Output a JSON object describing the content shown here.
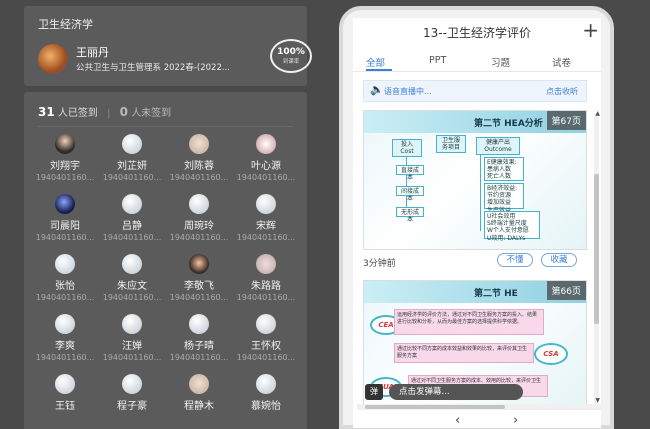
{
  "course": {
    "title": "卫生经济学",
    "teacher_name": "王丽丹",
    "teacher_org": "公共卫生与卫生管理系 2022春-(2022...",
    "progress_pct": "100%",
    "progress_label": "到课率"
  },
  "attendance": {
    "signed_count": "31",
    "signed_label": "人已签到",
    "separator": "|",
    "unsigned_count": "0",
    "unsigned_label": "人未签到",
    "students": [
      {
        "name": "刘翔宇",
        "id": "1940401160...",
        "avatar": "photo1"
      },
      {
        "name": "刘芷妍",
        "id": "1940401160...",
        "avatar": "default"
      },
      {
        "name": "刘陈蓉",
        "id": "1940401160...",
        "avatar": "photo7"
      },
      {
        "name": "叶心源",
        "id": "1940401160...",
        "avatar": "photo6"
      },
      {
        "name": "司晨阳",
        "id": "1940401160...",
        "avatar": "photo5"
      },
      {
        "name": "吕静",
        "id": "1940401160...",
        "avatar": "default"
      },
      {
        "name": "周琬玲",
        "id": "1940401160...",
        "avatar": "default"
      },
      {
        "name": "宋辉",
        "id": "1940401160...",
        "avatar": "default"
      },
      {
        "name": "张怡",
        "id": "1940401160...",
        "avatar": "default"
      },
      {
        "name": "朱应文",
        "id": "1940401160...",
        "avatar": "default"
      },
      {
        "name": "李敬飞",
        "id": "1940401160...",
        "avatar": "photo3"
      },
      {
        "name": "朱路路",
        "id": "1940401160...",
        "avatar": "photo4"
      },
      {
        "name": "李爽",
        "id": "1940401160...",
        "avatar": "default"
      },
      {
        "name": "汪婵",
        "id": "1940401160...",
        "avatar": "default"
      },
      {
        "name": "杨子晴",
        "id": "1940401160...",
        "avatar": "default"
      },
      {
        "name": "王怀权",
        "id": "1940401160...",
        "avatar": "default"
      },
      {
        "name": "王钰",
        "id": "",
        "avatar": "default"
      },
      {
        "name": "程子豪",
        "id": "",
        "avatar": "default"
      },
      {
        "name": "程静木",
        "id": "",
        "avatar": "photo7"
      },
      {
        "name": "慕婉怡",
        "id": "",
        "avatar": "default"
      }
    ]
  },
  "phone": {
    "title": "13--卫生经济学评价",
    "plus_icon": "+",
    "tabs": [
      {
        "label": "全部",
        "active": true
      },
      {
        "label": "PPT",
        "active": false
      },
      {
        "label": "习题",
        "active": false
      },
      {
        "label": "试卷",
        "active": false
      }
    ],
    "live": {
      "text": "语音直播中...",
      "collapse": "点击收听"
    },
    "slide1": {
      "heading": "第二节 HEA分析",
      "page": "第67页",
      "boxes": {
        "input": "投入\nCost",
        "service": "卫生服\n务项目",
        "output": "健康产出\nOutcome",
        "direct": "直接成本",
        "indirect": "间接成本",
        "intangible": "无形成本",
        "effect": "E健康效果:\n患病人数\n死亡人数",
        "benefit": "B经济效益:\n节约资源\n增加效益\n生产效益",
        "utility": "U社会效用\nS终端计量尺度\nW个人支付意愿\nU效用: DALYs"
      }
    },
    "timestamp": "3分钟前",
    "btn_dontknow": "不懂",
    "btn_favorite": "收藏",
    "slide2": {
      "heading": "第二节 HE",
      "page": "第66页",
      "cea": "CEA",
      "csa": "CSA",
      "cua": "CUA",
      "text1": "运用经济学的评价方法，通过对不同卫生服务方案的投入、结果进行比较和分析，从而为最佳方案的选择提供科学依据。",
      "text2": "通过比较不同方案的成本效益和效果的比较，来评价其卫生服务方案",
      "text3": "通过对不同卫生服务方案的成本、效用的比较，来评价卫生服务方案"
    },
    "danmu_badge": "弹",
    "danmu_placeholder": "点击发弹幕...",
    "nav_prev": "‹",
    "nav_next": "›"
  }
}
